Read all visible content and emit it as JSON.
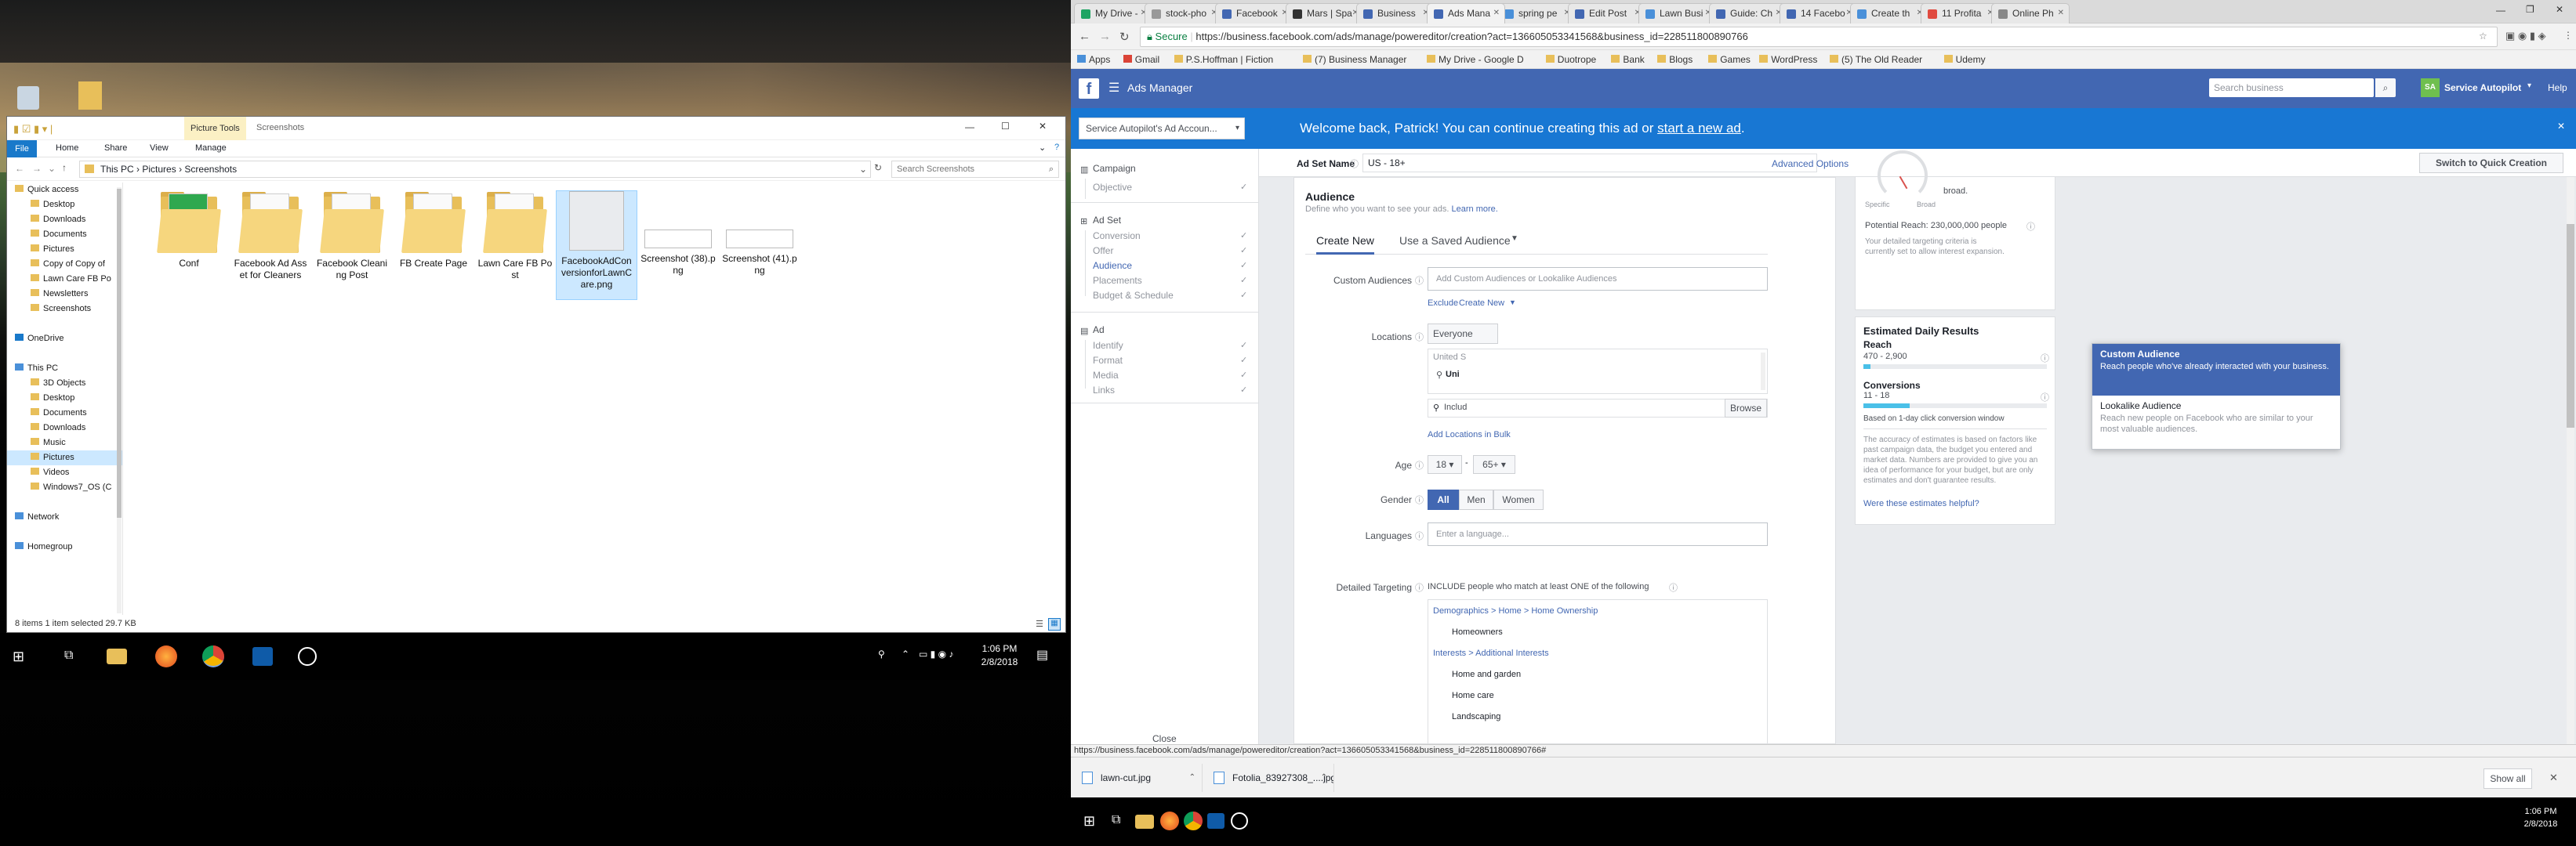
{
  "explorer": {
    "title": "Screenshots",
    "ribbon_context": "Picture Tools",
    "ribbon_tabs": [
      "File",
      "Home",
      "Share",
      "View",
      "Manage"
    ],
    "path": [
      "This PC",
      "Pictures",
      "Screenshots"
    ],
    "search_placeholder": "Search Screenshots",
    "nav_items": [
      {
        "label": "Quick access",
        "indent": 0
      },
      {
        "label": "Desktop",
        "indent": 1
      },
      {
        "label": "Downloads",
        "indent": 1
      },
      {
        "label": "Documents",
        "indent": 1
      },
      {
        "label": "Pictures",
        "indent": 1
      },
      {
        "label": "Copy of Copy of",
        "indent": 1
      },
      {
        "label": "Lawn Care FB Po",
        "indent": 1
      },
      {
        "label": "Newsletters",
        "indent": 1
      },
      {
        "label": "Screenshots",
        "indent": 1
      },
      {
        "label": "",
        "indent": 0
      },
      {
        "label": "OneDrive",
        "indent": 0
      },
      {
        "label": "",
        "indent": 0
      },
      {
        "label": "This PC",
        "indent": 0
      },
      {
        "label": "3D Objects",
        "indent": 1
      },
      {
        "label": "Desktop",
        "indent": 1
      },
      {
        "label": "Documents",
        "indent": 1
      },
      {
        "label": "Downloads",
        "indent": 1
      },
      {
        "label": "Music",
        "indent": 1
      },
      {
        "label": "Pictures",
        "indent": 1
      },
      {
        "label": "Videos",
        "indent": 1
      },
      {
        "label": "Windows7_OS (C",
        "indent": 1
      },
      {
        "label": "",
        "indent": 0
      },
      {
        "label": "Network",
        "indent": 0
      },
      {
        "label": "",
        "indent": 0
      },
      {
        "label": "Homegroup",
        "indent": 0
      }
    ],
    "files": [
      {
        "label": "Conf",
        "type": "folder-green"
      },
      {
        "label": "Facebook Ad Asset for Cleaners",
        "type": "folder"
      },
      {
        "label": "Facebook Cleaning Post",
        "type": "folder"
      },
      {
        "label": "FB Create Page",
        "type": "folder"
      },
      {
        "label": "Lawn Care FB Post",
        "type": "folder"
      },
      {
        "label": "FacebookAdConversionforLawnCare.png",
        "type": "image-selected"
      },
      {
        "label": "Screenshot (38).png",
        "type": "image"
      },
      {
        "label": "Screenshot (41).png",
        "type": "image"
      }
    ],
    "status": "8 items    1 item selected  29.7 KB"
  },
  "left_taskbar": {
    "time": "1:06 PM",
    "date": "2/8/2018"
  },
  "chrome": {
    "tabs": [
      "My Drive -",
      "stock-pho",
      "Facebook",
      "Mars | Spa",
      "Business",
      "Ads Mana",
      "spring pe",
      "Edit Post",
      "Lawn Busi",
      "Guide: Ch",
      "14 Facebo",
      "Create th",
      "11 Profita",
      "Online Ph"
    ],
    "active_tab_index": 5,
    "secure_label": "Secure",
    "url": "https://business.facebook.com/ads/manage/powereditor/creation?act=136605053341568&business_id=228511800890766",
    "bookmarks": [
      "Apps",
      "Gmail",
      "P.S.Hoffman | Fiction",
      "(7) Business Manager",
      "My Drive - Google D",
      "Duotrope",
      "Bank",
      "Blogs",
      "Games",
      "WordPress",
      "(5) The Old Reader",
      "Udemy"
    ]
  },
  "fb": {
    "app_title": "Ads Manager",
    "search_placeholder": "Search business",
    "account_name": "Service Autopilot",
    "help_label": "Help",
    "banner_text": "Welcome back, Patrick! You can continue creating this ad or ",
    "banner_link": "start a new ad",
    "account_select": "Service Autopilot's Ad Accoun...",
    "ad_set_name_label": "Ad Set Name",
    "ad_set_name_value": "US - 18+",
    "advanced_options": "Advanced Options",
    "switch_quick": "Switch to Quick Creation",
    "nav": {
      "campaign": "Campaign",
      "campaign_items": [
        "Objective"
      ],
      "adset": "Ad Set",
      "adset_items": [
        "Conversion",
        "Offer",
        "Audience",
        "Placements",
        "Budget & Schedule"
      ],
      "ad": "Ad",
      "ad_items": [
        "Identify",
        "Format",
        "Media",
        "Links"
      ]
    },
    "audience": {
      "heading": "Audience",
      "subtitle": "Define who you want to see your ads. ",
      "learn_more": "Learn more.",
      "tab_new": "Create New",
      "tab_saved": "Use a Saved Audience",
      "custom_audiences_label": "Custom Audiences",
      "custom_audiences_placeholder": "Add Custom Audiences or Lookalike Audiences",
      "exclude": "Exclude",
      "create_new": "Create New",
      "locations_label": "Locations",
      "locations_value": "Everyone",
      "location_country": "United S",
      "location_selected": "Uni",
      "include": "Includ",
      "browse": "Browse",
      "add_bulk": "Add Locations in Bulk",
      "age_label": "Age",
      "age_min": "18",
      "age_max": "65+",
      "gender_label": "Gender",
      "genders": [
        "All",
        "Men",
        "Women"
      ],
      "languages_label": "Languages",
      "languages_placeholder": "Enter a language...",
      "detailed_label": "Detailed Targeting",
      "detailed_desc": "INCLUDE people who match at least ONE of the following",
      "detailed_items": [
        {
          "text": "Demographics > Home > Home Ownership",
          "kind": "path"
        },
        {
          "text": "Homeowners",
          "kind": "item"
        },
        {
          "text": "Interests > Additional Interests",
          "kind": "path"
        },
        {
          "text": "Home and garden",
          "kind": "item"
        },
        {
          "text": "Home care",
          "kind": "item"
        },
        {
          "text": "Landscaping",
          "kind": "item"
        }
      ]
    },
    "dropdown": [
      {
        "title": "Custom Audience",
        "desc": "Reach people who've already interacted with your business."
      },
      {
        "title": "Lookalike Audience",
        "desc": "Reach new people on Facebook who are similar to your most valuable audiences."
      }
    ],
    "right": {
      "gauge_specific": "Specific",
      "gauge_broad": "Broad",
      "gauge_note": "broad.",
      "potential_reach": "Potential Reach: 230,000,000 people",
      "expansion_note": "Your detailed targeting criteria is currently set to allow interest expansion.",
      "daily_heading": "Estimated Daily Results",
      "reach_label": "Reach",
      "reach_value": "470 - 2,900",
      "reach_fill": 0.04,
      "conversions_label": "Conversions",
      "conversions_value": "11 - 18",
      "conversions_fill": 0.25,
      "window_note": "Based on 1-day click conversion window",
      "accuracy_note": "The accuracy of estimates is based on factors like past campaign data, the budget you entered and market data. Numbers are provided to give you an idea of performance for your budget, but are only estimates and don't guarantee results.",
      "helpful_link": "Were these estimates helpful?"
    },
    "close_label": "Close"
  },
  "status_url": "https://business.facebook.com/ads/manage/powereditor/creation?act=136605053341568&business_id=228511800890766#",
  "downloads": [
    "lawn-cut.jpg",
    "Fotolia_83927308_....jpg"
  ],
  "show_all": "Show all",
  "right_taskbar": {
    "time": "1:06 PM",
    "date": "2/8/2018"
  }
}
